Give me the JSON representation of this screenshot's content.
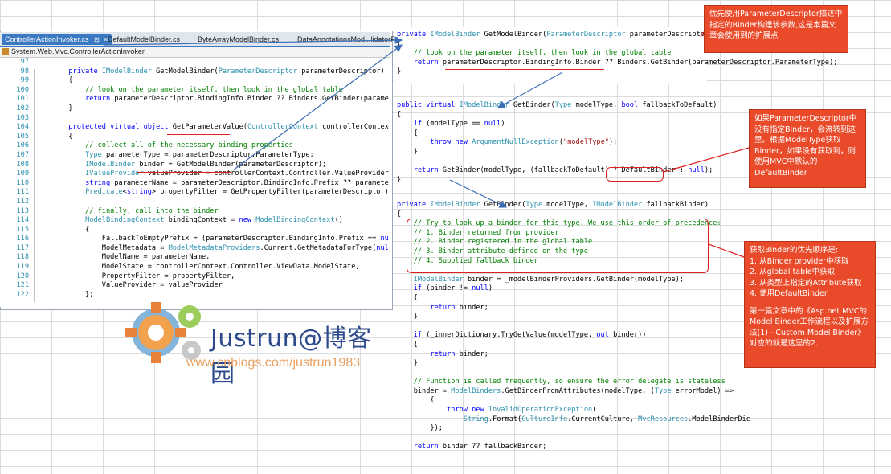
{
  "tabs": [
    {
      "label": "ControllerActionInvoker.cs",
      "active": true
    },
    {
      "label": "DefaultModelBinder.cs",
      "active": false
    },
    {
      "label": "ByteArrayModelBinder.cs",
      "active": false
    },
    {
      "label": "DataAnnotationsMod...lidatorPro",
      "active": false
    }
  ],
  "tab_icons": {
    "pin": "⊡",
    "close": "✕"
  },
  "namespace": "System.Web.Mvc.ControllerActionInvoker",
  "left_code": {
    "line_numbers": [
      "97",
      "98",
      "99",
      "100",
      "101",
      "102",
      "103",
      "104",
      "105",
      "106",
      "107",
      "108",
      "109",
      "110",
      "111",
      "112",
      "113",
      "114",
      "115",
      "116",
      "117",
      "118",
      "119",
      "120",
      "121",
      "122"
    ],
    "lines": [
      "",
      "        private IModelBinder GetModelBinder(ParameterDescriptor parameterDescriptor)",
      "        {",
      "            // look on the parameter itself, then look in the global table",
      "            return parameterDescriptor.BindingInfo.Binder ?? Binders.GetBinder(parameterDes",
      "        }",
      "",
      "        protected virtual object GetParameterValue(ControllerContext controllerContext, Pa",
      "        {",
      "            // collect all of the necessary binding properties",
      "            Type parameterType = parameterDescriptor.ParameterType;",
      "            IModelBinder binder = GetModelBinder(parameterDescriptor);",
      "            IValueProvider valueProvider = controllerContext.Controller.ValueProvider;",
      "            string parameterName = parameterDescriptor.BindingInfo.Prefix ?? parameterDesc",
      "            Predicate<string> propertyFilter = GetPropertyFilter(parameterDescriptor);",
      "",
      "            // finally, call into the binder",
      "            ModelBindingContext bindingContext = new ModelBindingContext()",
      "            {",
      "                FallbackToEmptyPrefix = (parameterDescriptor.BindingInfo.Prefix == null),",
      "                ModelMetadata = ModelMetadataProviders.Current.GetMetadataForType(null, pa",
      "                ModelName = parameterName,",
      "                ModelState = controllerContext.Controller.ViewData.ModelState,",
      "                PropertyFilter = propertyFilter,",
      "                ValueProvider = valueProvider",
      "            };"
    ]
  },
  "right_block1": [
    "private IModelBinder GetModelBinder(ParameterDescriptor parameterDescriptor)",
    "{",
    "    // look on the parameter itself, then look in the global table",
    "    return parameterDescriptor.BindingInfo.Binder ?? Binders.GetBinder(parameterDescriptor.ParameterType);",
    "}"
  ],
  "right_block2": [
    "public virtual IModelBinder GetBinder(Type modelType, bool fallbackToDefault)",
    "{",
    "    if (modelType == null)",
    "    {",
    "        throw new ArgumentNullException(\"modelType\");",
    "    }",
    "",
    "    return GetBinder(modelType, (fallbackToDefault) ? DefaultBinder : null);",
    "}"
  ],
  "right_block3": [
    "private IModelBinder GetBinder(Type modelType, IModelBinder fallbackBinder)",
    "{",
    "    // Try to look up a binder for this type. We use this order of precedence:",
    "    // 1. Binder returned from provider",
    "    // 2. Binder registered in the global table",
    "    // 3. Binder attribute defined on the type",
    "    // 4. Supplied fallback binder",
    "",
    "    IModelBinder binder = _modelBinderProviders.GetBinder(modelType);",
    "    if (binder != null)",
    "    {",
    "        return binder;",
    "    }",
    "",
    "    if (_innerDictionary.TryGetValue(modelType, out binder))",
    "    {",
    "        return binder;",
    "    }",
    "",
    "    // Function is called frequently, so ensure the error delegate is stateless",
    "    binder = ModelBinders.GetBinderFromAttributes(modelType, (Type errorModel) =>",
    "        {",
    "            throw new InvalidOperationException(",
    "                String.Format(CultureInfo.CurrentCulture, MvcResources.ModelBinderDic",
    "        });",
    "",
    "    return binder ?? fallbackBinder;"
  ],
  "annotations": {
    "note1": "优先使用ParameterDescriptor描述中指定的Binder构建该参数,这是本篇文章会使用到的扩展点",
    "note2": "如果ParameterDescriptor中没有指定Binder，会流转到这里。根据ModelType获取Binder，如果没有获取到，则使用MVC中默认的DefaultBinder",
    "note3_title": "获取Binder的优先顺序是:",
    "note3_items": [
      "1. 从Binder provider中获取",
      "2. 从global table中获取",
      "3. 从类型上指定的Attribute获取",
      "4. 使用DefaultBinder"
    ],
    "note3_footer": "第一篇文章中的《Asp.net MVC的Model Binder工作流程以及扩展方法(1) - Custom Model Binder》对应的就是这里的2."
  },
  "watermark": {
    "title": "Justrun@博客园",
    "url": "www.cnblogs.com/justrun1983"
  },
  "colors": {
    "keyword": "#0000ff",
    "type": "#2b91af",
    "comment": "#008000",
    "string": "#a31515",
    "annotation_bg": "#e84a2a",
    "highlight": "#e02020",
    "tab_active": "#3a78c2"
  }
}
